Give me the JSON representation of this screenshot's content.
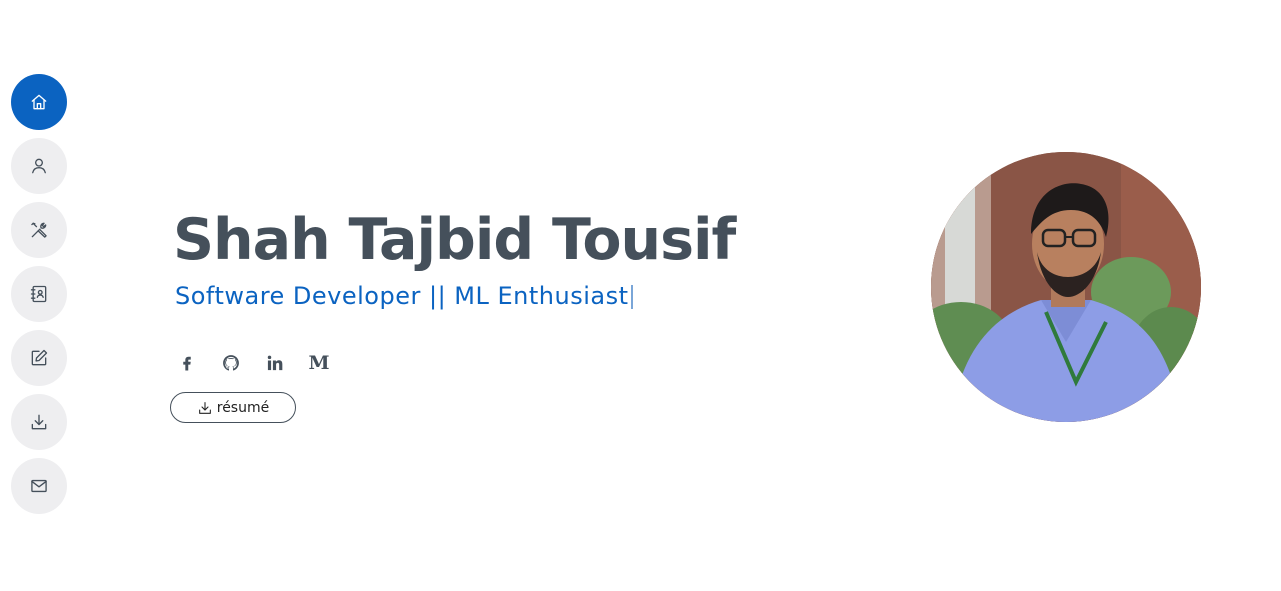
{
  "sidebar": {
    "items": [
      {
        "id": "home",
        "icon": "home-icon",
        "active": true
      },
      {
        "id": "about",
        "icon": "user-icon",
        "active": false
      },
      {
        "id": "skills",
        "icon": "tools-icon",
        "active": false
      },
      {
        "id": "resume",
        "icon": "contact-book-icon",
        "active": false
      },
      {
        "id": "blog",
        "icon": "edit-icon",
        "active": false
      },
      {
        "id": "download",
        "icon": "download-icon",
        "active": false
      },
      {
        "id": "contact",
        "icon": "mail-icon",
        "active": false
      }
    ]
  },
  "hero": {
    "name": "Shah Tajbid Tousif",
    "subtitle": "Software Developer || ML Enthusiast"
  },
  "socials": [
    {
      "id": "facebook",
      "icon": "facebook-icon"
    },
    {
      "id": "github",
      "icon": "github-icon"
    },
    {
      "id": "linkedin",
      "icon": "linkedin-icon"
    },
    {
      "id": "medium",
      "icon": "medium-icon",
      "glyph": "M"
    }
  ],
  "resume_button": {
    "label": "résumé",
    "icon": "download-icon"
  },
  "colors": {
    "accent": "#0b63c1",
    "text": "#45505b",
    "nav_bg": "#eeeef0"
  }
}
